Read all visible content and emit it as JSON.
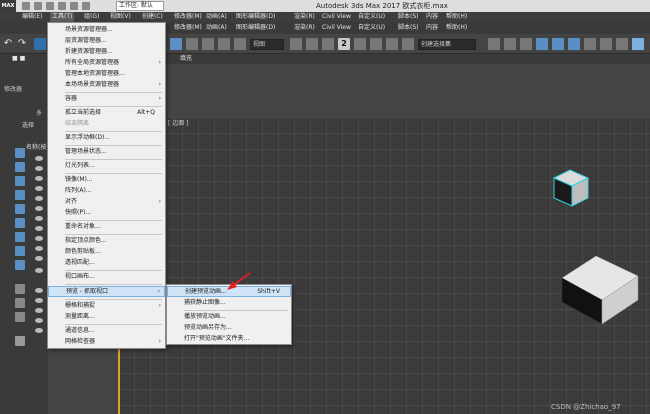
{
  "titlebar": {
    "logo": "MAX",
    "workspace": "工作区: 默认",
    "title": "Autodesk 3ds Max 2017      欧式衣柜.max"
  },
  "menubar": {
    "items": [
      "编辑(E)",
      "工具(T)",
      "组(G)",
      "视图(V)",
      "创建(C)",
      "修改器(M)",
      "动画(A)",
      "图形编辑器(D)",
      "渲染(R)",
      "Civil View",
      "自定义(U)",
      "脚本(S)",
      "内容",
      "帮助(H)"
    ]
  },
  "row2": {
    "items": [
      "修改器(M)",
      "动画(A)",
      "图形编辑器(D)",
      "渲染(R)",
      "Civil View",
      "自定义(U)",
      "脚本(S)",
      "内容",
      "帮助(H)"
    ]
  },
  "toolbar": {
    "view_combo": "视图",
    "selection_set": "创建选择集"
  },
  "row4": {
    "fill_label": "填充"
  },
  "left": {
    "tab_label": "选择",
    "name_header": "名称(按",
    "modify_label": "修改器",
    "more_label": "多"
  },
  "viewport": {
    "label": "[ 边面 ]"
  },
  "tools_menu": {
    "items": [
      {
        "label": "场景资源管理器...",
        "shortcut": "",
        "sub": false,
        "disabled": false
      },
      {
        "label": "层资源管理器...",
        "shortcut": "",
        "sub": false,
        "disabled": false
      },
      {
        "label": "折建资源管理器...",
        "shortcut": "",
        "sub": false,
        "disabled": false
      },
      {
        "label": "所有全局资源管理器",
        "shortcut": "",
        "sub": true,
        "disabled": false
      },
      {
        "label": "管理本地资源管理器...",
        "shortcut": "",
        "sub": false,
        "disabled": false
      },
      {
        "label": "本场场景资源管理器",
        "shortcut": "",
        "sub": true,
        "disabled": false
      },
      {
        "label": "容器",
        "shortcut": "",
        "sub": true,
        "disabled": false
      },
      {
        "label": "孤立当前选择",
        "shortcut": "Alt+Q",
        "sub": false,
        "disabled": false
      },
      {
        "label": "结束隔离",
        "shortcut": "",
        "sub": false,
        "disabled": true
      },
      {
        "label": "显示浮动框(D)...",
        "shortcut": "",
        "sub": false,
        "disabled": false
      },
      {
        "label": "管理场景状态...",
        "shortcut": "",
        "sub": false,
        "disabled": false
      },
      {
        "label": "灯光列表...",
        "shortcut": "",
        "sub": false,
        "disabled": false
      },
      {
        "label": "镜像(M)...",
        "shortcut": "",
        "sub": false,
        "disabled": false
      },
      {
        "label": "阵列(A)...",
        "shortcut": "",
        "sub": false,
        "disabled": false
      },
      {
        "label": "对齐",
        "shortcut": "",
        "sub": true,
        "disabled": false
      },
      {
        "label": "快照(P)...",
        "shortcut": "",
        "sub": false,
        "disabled": false
      },
      {
        "label": "重命名对象...",
        "shortcut": "",
        "sub": false,
        "disabled": false
      },
      {
        "label": "指定顶点颜色...",
        "shortcut": "",
        "sub": false,
        "disabled": false
      },
      {
        "label": "颜色剪贴板...",
        "shortcut": "",
        "sub": false,
        "disabled": false
      },
      {
        "label": "透视匹配...",
        "shortcut": "",
        "sub": false,
        "disabled": false
      },
      {
        "label": "视口画布...",
        "shortcut": "",
        "sub": false,
        "disabled": false
      },
      {
        "label": "预览 - 抓取视口",
        "shortcut": "",
        "sub": true,
        "disabled": false
      },
      {
        "label": "栅格和捕捉",
        "shortcut": "",
        "sub": true,
        "disabled": false
      },
      {
        "label": "测量距离...",
        "shortcut": "",
        "sub": false,
        "disabled": false
      },
      {
        "label": "通道信息...",
        "shortcut": "",
        "sub": false,
        "disabled": false
      },
      {
        "label": "网格检查器",
        "shortcut": "",
        "sub": true,
        "disabled": false
      }
    ]
  },
  "preview_submenu": {
    "items": [
      {
        "label": "创建预览动画...",
        "shortcut": "Shift+V"
      },
      {
        "label": "捕获静止图像...",
        "shortcut": ""
      },
      {
        "label": "播放预览动画...",
        "shortcut": ""
      },
      {
        "label": "预览动画另存为...",
        "shortcut": ""
      },
      {
        "label": "打开\"预览动画\"文件夹...",
        "shortcut": ""
      }
    ]
  },
  "watermark": "CSDN @Zhichao_97",
  "colors": {
    "accent_cyan": "#31d1e6",
    "arrow_red": "#e02020",
    "highlight": "#cfe4f7"
  }
}
